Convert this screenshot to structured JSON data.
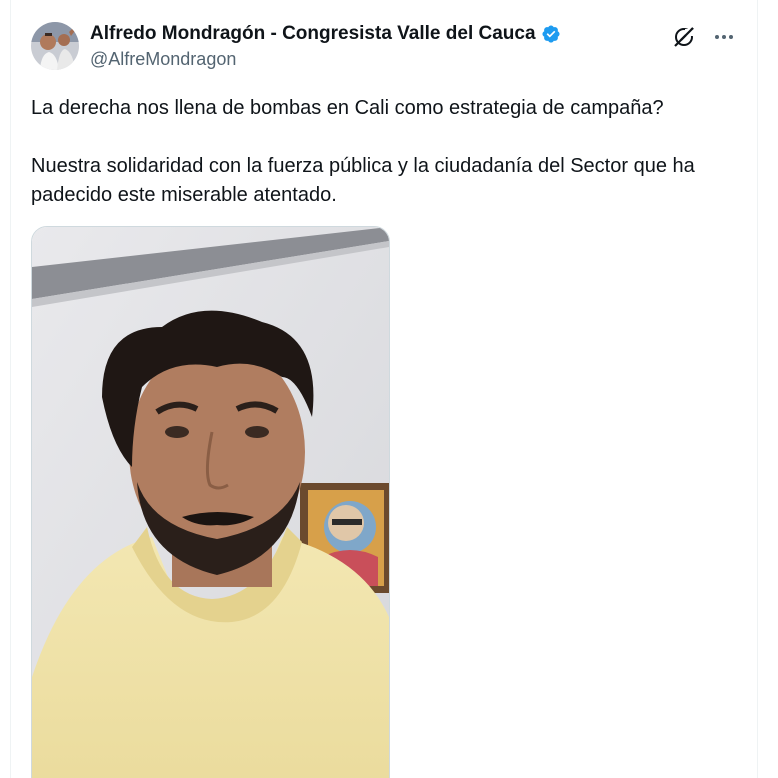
{
  "tweet": {
    "author": {
      "display_name": "Alfredo Mondragón - Congresista Valle del Cauca",
      "handle": "@AlfreMondragon",
      "verified_badge_color": "#1d9bf0"
    },
    "header_icons": [
      "grok-icon",
      "more-options-icon"
    ],
    "paragraphs": [
      "La derecha nos llena de bombas en Cali como estrategia de campaña?",
      "Nuestra solidaridad con la fuerza pública y la ciudadanía del Sector que ha padecido este miserable atentado."
    ],
    "media": {
      "type": "video-thumbnail",
      "description_icon": "video-still-image"
    }
  },
  "colors": {
    "text_primary": "#0f1419",
    "text_secondary": "#536471",
    "border": "#cfd9de",
    "verified": "#1d9bf0"
  }
}
